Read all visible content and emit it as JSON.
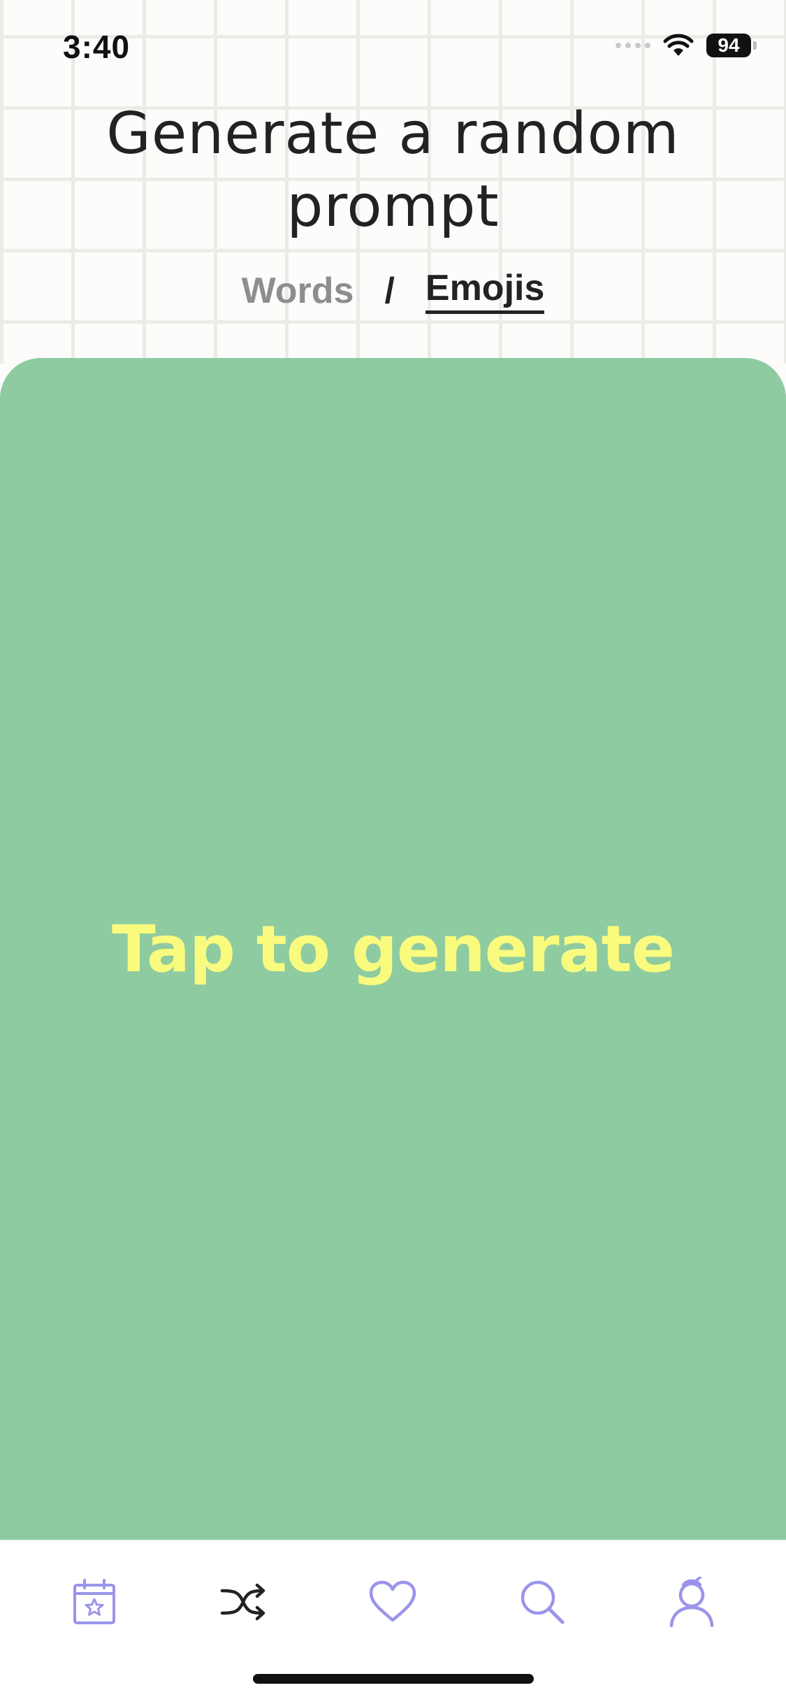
{
  "status_bar": {
    "time": "3:40",
    "battery": "94"
  },
  "header": {
    "title": "Generate a random prompt"
  },
  "mode_toggle": {
    "words_label": "Words",
    "separator": "/",
    "emojis_label": "Emojis",
    "selected": "Emojis"
  },
  "card": {
    "label": "Tap to generate",
    "background_color": "#8ecba1",
    "text_color": "#f9fb7e"
  },
  "tab_bar": {
    "items": [
      {
        "icon": "calendar-star-icon",
        "active": false
      },
      {
        "icon": "shuffle-icon",
        "active": true
      },
      {
        "icon": "heart-icon",
        "active": false
      },
      {
        "icon": "search-icon",
        "active": false
      },
      {
        "icon": "profile-icon",
        "active": false
      }
    ],
    "accent_color": "#9a95ea",
    "active_color": "#222222"
  }
}
